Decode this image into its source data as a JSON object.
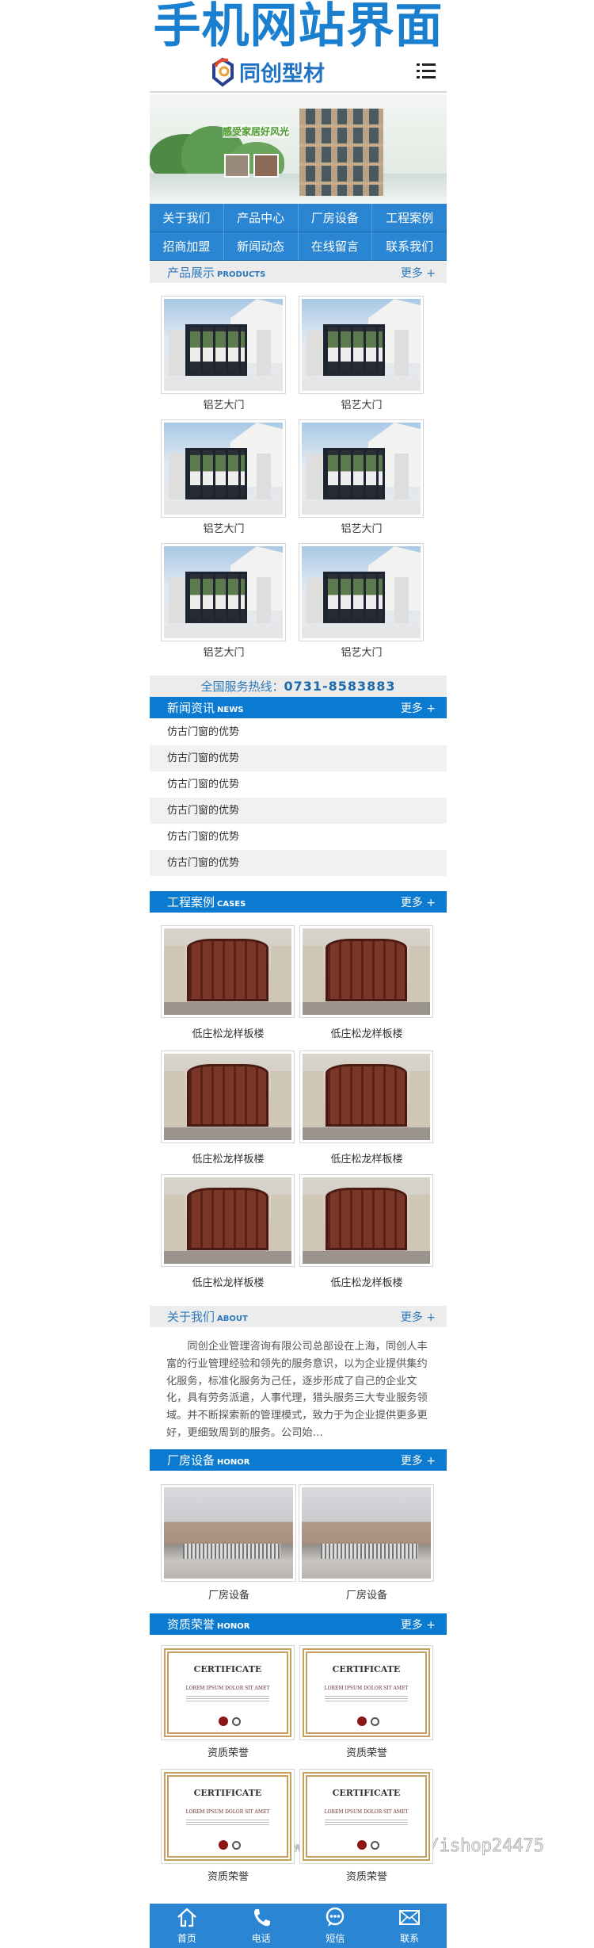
{
  "promo_title": "手机网站界面",
  "header": {
    "logo_text": "同创型材",
    "menu_icon": "menu-list-icon"
  },
  "banner": {
    "slogan": "感受家居好风光"
  },
  "nav": [
    "关于我们",
    "产品中心",
    "厂房设备",
    "工程案例",
    "招商加盟",
    "新闻动态",
    "在线留言",
    "联系我们"
  ],
  "products": {
    "title": "产品展示",
    "en": "PRODUCTS",
    "more": "更多 +",
    "items": [
      "铝艺大门",
      "铝艺大门",
      "铝艺大门",
      "铝艺大门",
      "铝艺大门",
      "铝艺大门"
    ]
  },
  "hotline": {
    "label": "全国服务热线：",
    "number": "0731-8583883"
  },
  "news": {
    "title": "新闻资讯",
    "en": "NEWS",
    "more": "更多 +",
    "items": [
      "仿古门窗的优势",
      "仿古门窗的优势",
      "仿古门窗的优势",
      "仿古门窗的优势",
      "仿古门窗的优势",
      "仿古门窗的优势"
    ]
  },
  "cases": {
    "title": "工程案例",
    "en": "CASES",
    "more": "更多 +",
    "items": [
      "低庄松龙样板楼",
      "低庄松龙样板楼",
      "低庄松龙样板楼",
      "低庄松龙样板楼",
      "低庄松龙样板楼",
      "低庄松龙样板楼"
    ]
  },
  "about": {
    "title": "关于我们",
    "en": "ABOUT",
    "more": "更多 +",
    "text": "同创企业管理咨询有限公司总部设在上海，同创人丰富的行业管理经验和领先的服务意识，以为企业提供集约化服务，标准化服务为己任，逐步形成了自己的企业文化，具有劳务派遣，人事代理，猎头服务三大专业服务领域。并不断探索新的管理模式，致力于为企业提供更多更好，更细致周到的服务。公司始…"
  },
  "factory": {
    "title": "厂房设备",
    "en": "HONOR",
    "more": "更多 +",
    "items": [
      "厂房设备",
      "厂房设备"
    ]
  },
  "honor": {
    "title": "资质荣誉",
    "en": "HONOR",
    "more": "更多 +",
    "items": [
      "资质荣誉",
      "资质荣誉",
      "资质荣誉",
      "资质荣誉"
    ],
    "cert_heading": "CERTIFICATE",
    "cert_line": "LOREM IPSUM DOLOR SIT AMET"
  },
  "bottom_nav": [
    {
      "label": "首页",
      "icon": "home-icon"
    },
    {
      "label": "电话",
      "icon": "phone-icon"
    },
    {
      "label": "短信",
      "icon": "message-icon"
    },
    {
      "label": "联系",
      "icon": "mail-icon"
    }
  ],
  "watermark": "https://www.huzhan.com/ishop24475",
  "colors": {
    "primary": "#0a7bd0",
    "nav": "#2a86d3",
    "title": "#1a7fcf",
    "gray_bar": "#ececec"
  }
}
